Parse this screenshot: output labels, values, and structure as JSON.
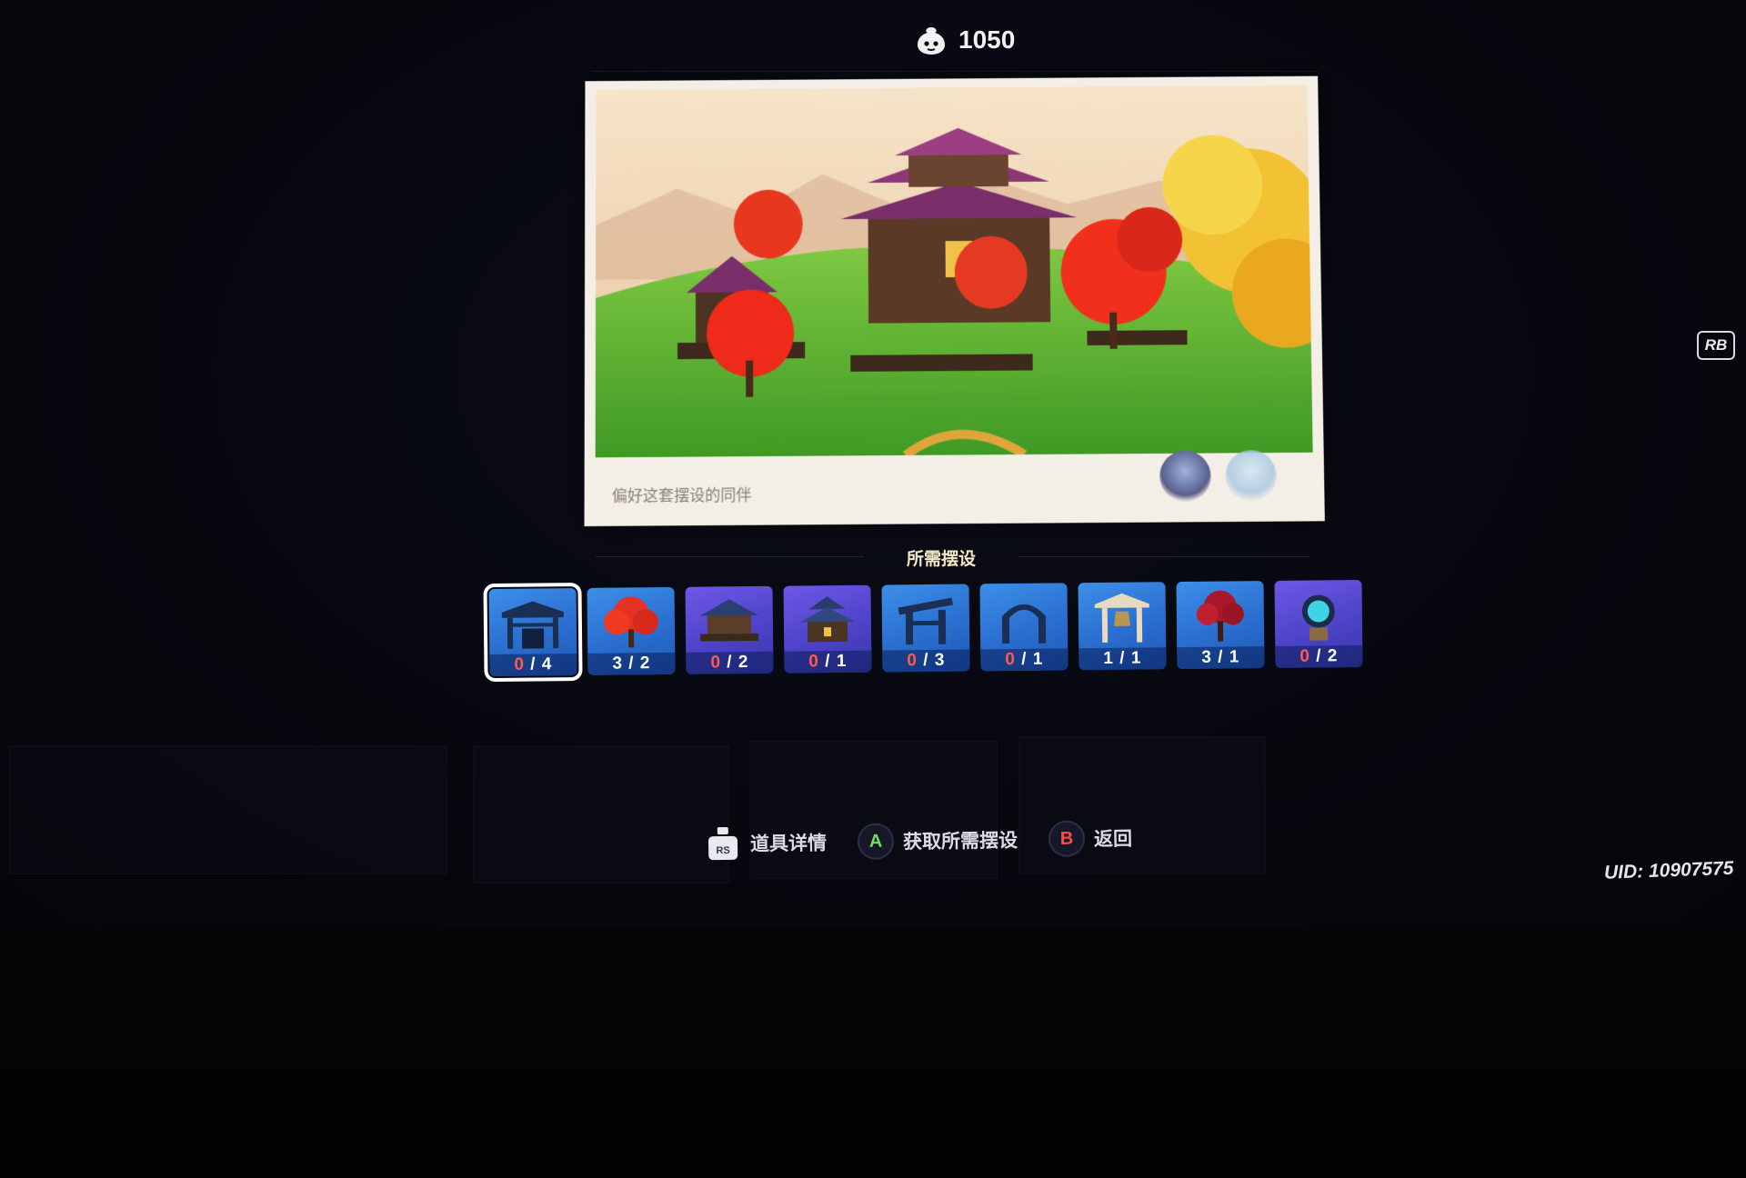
{
  "header": {
    "currency_icon": "realm-currency-icon",
    "currency_value": "1050"
  },
  "preview": {
    "companion_label": "偏好这套摆设的同伴"
  },
  "required": {
    "title": "所需摆设",
    "items": [
      {
        "icon": "fence-gate-icon",
        "owned": "0",
        "required": "4",
        "color": "blue",
        "selected": true
      },
      {
        "icon": "red-maple-tree-icon",
        "owned": "3",
        "required": "2",
        "color": "blue",
        "selected": false
      },
      {
        "icon": "pavilion-icon",
        "owned": "0",
        "required": "2",
        "color": "purple",
        "selected": false
      },
      {
        "icon": "castle-icon",
        "owned": "0",
        "required": "1",
        "color": "purple",
        "selected": false
      },
      {
        "icon": "wooden-gate-icon",
        "owned": "0",
        "required": "3",
        "color": "blue",
        "selected": false
      },
      {
        "icon": "arch-gate-icon",
        "owned": "0",
        "required": "1",
        "color": "blue",
        "selected": false
      },
      {
        "icon": "bell-tower-icon",
        "owned": "1",
        "required": "1",
        "color": "blue",
        "selected": false
      },
      {
        "icon": "crimson-tree-icon",
        "owned": "3",
        "required": "1",
        "color": "blue",
        "selected": false
      },
      {
        "icon": "teleport-waypoint-icon",
        "owned": "0",
        "required": "2",
        "color": "purple",
        "selected": false
      }
    ]
  },
  "hints": {
    "item_details": "道具详情",
    "acquire_all": "获取所需摆设",
    "back": "返回",
    "a_key": "A",
    "b_key": "B",
    "rs_key": "RS"
  },
  "rb_label": "RB",
  "uid": "UID: 10907575"
}
